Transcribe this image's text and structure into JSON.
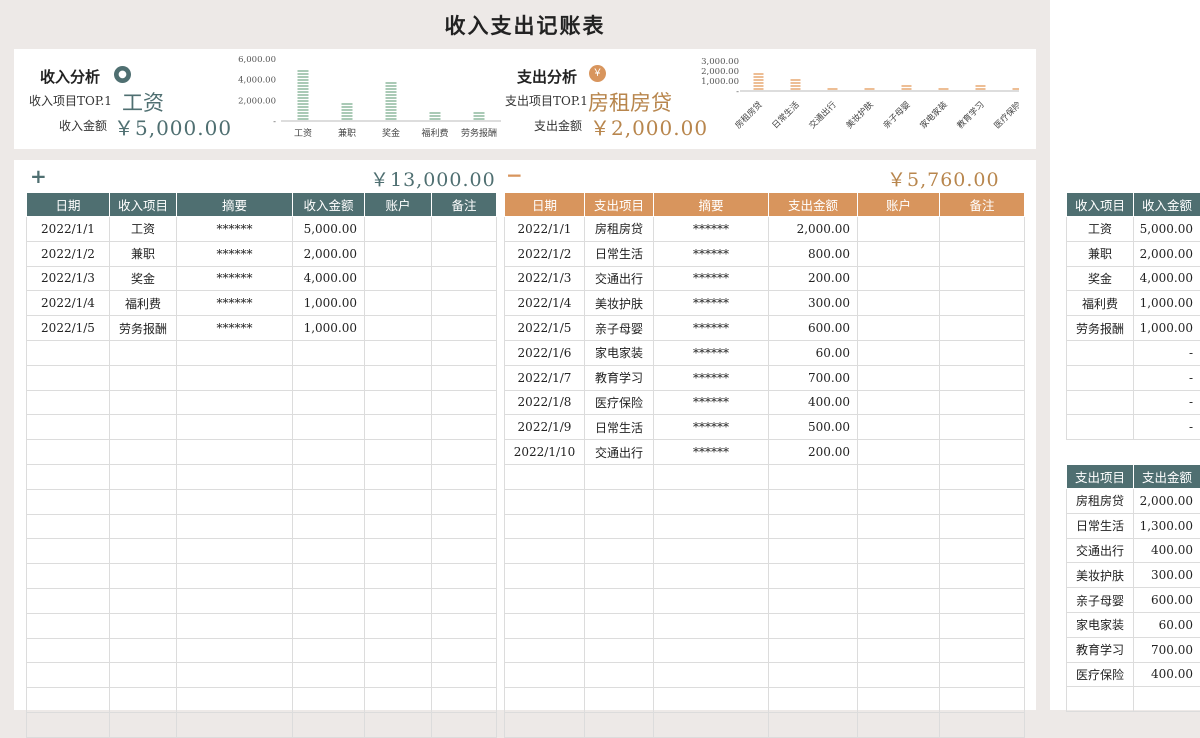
{
  "title": "收入支出记账表",
  "colors": {
    "income": "#4f6f71",
    "expense": "#d8955d",
    "income_chart": "#7cae8e",
    "expense_chart": "#e39a5c"
  },
  "income": {
    "label": "收入分析",
    "top_label": "收入项目TOP.1",
    "top_value": "工资",
    "amount_label": "收入金额",
    "amount_value": "￥5,000.00",
    "sign": "+",
    "total": "￥13,000.00",
    "headers": [
      "日期",
      "收入项目",
      "摘要",
      "收入金额",
      "账户",
      "备注"
    ],
    "rows": [
      [
        "2022/1/1",
        "工资",
        "******",
        "5,000.00"
      ],
      [
        "2022/1/2",
        "兼职",
        "******",
        "2,000.00"
      ],
      [
        "2022/1/3",
        "奖金",
        "******",
        "4,000.00"
      ],
      [
        "2022/1/4",
        "福利费",
        "******",
        "1,000.00"
      ],
      [
        "2022/1/5",
        "劳务报酬",
        "******",
        "1,000.00"
      ]
    ]
  },
  "expense": {
    "label": "支出分析",
    "top_label": "支出项目TOP.1",
    "top_value": "房租房贷",
    "amount_label": "支出金额",
    "amount_value": "￥2,000.00",
    "sign": "−",
    "total": "￥5,760.00",
    "headers": [
      "日期",
      "支出项目",
      "摘要",
      "支出金额",
      "账户",
      "备注"
    ],
    "rows": [
      [
        "2022/1/1",
        "房租房贷",
        "******",
        "2,000.00"
      ],
      [
        "2022/1/2",
        "日常生活",
        "******",
        "800.00"
      ],
      [
        "2022/1/3",
        "交通出行",
        "******",
        "200.00"
      ],
      [
        "2022/1/4",
        "美妆护肤",
        "******",
        "300.00"
      ],
      [
        "2022/1/5",
        "亲子母婴",
        "******",
        "600.00"
      ],
      [
        "2022/1/6",
        "家电家装",
        "******",
        "60.00"
      ],
      [
        "2022/1/7",
        "教育学习",
        "******",
        "700.00"
      ],
      [
        "2022/1/8",
        "医疗保险",
        "******",
        "400.00"
      ],
      [
        "2022/1/9",
        "日常生活",
        "******",
        "500.00"
      ],
      [
        "2022/1/10",
        "交通出行",
        "******",
        "200.00"
      ]
    ]
  },
  "income_summary": {
    "headers": [
      "收入项目",
      "收入金额"
    ],
    "rows": [
      [
        "工资",
        "5,000.00"
      ],
      [
        "兼职",
        "2,000.00"
      ],
      [
        "奖金",
        "4,000.00"
      ],
      [
        "福利费",
        "1,000.00"
      ],
      [
        "劳务报酬",
        "1,000.00"
      ],
      [
        "",
        "-"
      ],
      [
        "",
        "-"
      ],
      [
        "",
        "-"
      ],
      [
        "",
        "-"
      ]
    ]
  },
  "expense_summary": {
    "headers": [
      "支出项目",
      "支出金额"
    ],
    "rows": [
      [
        "房租房贷",
        "2,000.00"
      ],
      [
        "日常生活",
        "1,300.00"
      ],
      [
        "交通出行",
        "400.00"
      ],
      [
        "美妆护肤",
        "300.00"
      ],
      [
        "亲子母婴",
        "600.00"
      ],
      [
        "家电家装",
        "60.00"
      ],
      [
        "教育学习",
        "700.00"
      ],
      [
        "医疗保险",
        "400.00"
      ]
    ]
  },
  "chart_data": [
    {
      "type": "bar",
      "categories": [
        "工资",
        "兼职",
        "奖金",
        "福利费",
        "劳务报酬"
      ],
      "values": [
        5000,
        2000,
        4000,
        1000,
        1000
      ],
      "ylim": [
        0,
        6000
      ],
      "yticks": [
        "6,000.00",
        "4,000.00",
        "2,000.00",
        "-"
      ],
      "grid": false
    },
    {
      "type": "bar",
      "categories": [
        "房租房贷",
        "日常生活",
        "交通出行",
        "美妆护肤",
        "亲子母婴",
        "家电家装",
        "教育学习",
        "医疗保险"
      ],
      "values": [
        2000,
        1300,
        400,
        300,
        600,
        60,
        700,
        400
      ],
      "ylim": [
        0,
        3000
      ],
      "yticks": [
        "3,000.00",
        "2,000.00",
        "1,000.00",
        "-"
      ],
      "grid": false
    }
  ]
}
